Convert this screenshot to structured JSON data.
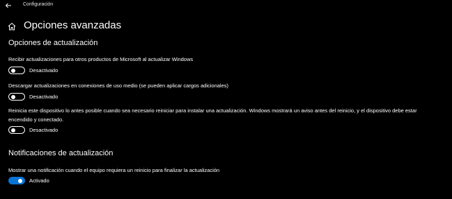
{
  "window": {
    "app_title": "Configuración",
    "back_icon": "back-arrow-icon"
  },
  "page": {
    "title": "Opciones avanzadas",
    "home_icon": "home-icon"
  },
  "update_options": {
    "heading": "Opciones de actualización",
    "items": [
      {
        "description": "Recibir actualizaciones para otros productos de Microsoft al actualizar Windows",
        "state_label": "Desactivado",
        "on": false
      },
      {
        "description": "Descargar actualizaciones en conexiones de uso medio (se pueden aplicar cargos adicionales)",
        "state_label": "Desactivado",
        "on": false
      },
      {
        "description_line1": "Reinicia este dispositivo lo antes posible cuando sea necesario reiniciar para instalar una actualización. Windows mostrará un aviso antes del reinicio, y el dispositivo debe estar",
        "description_line2": "encendido y conectado.",
        "state_label": "Desactivado",
        "on": false
      }
    ]
  },
  "notifications": {
    "heading": "Notificaciones de actualización",
    "items": [
      {
        "description": "Mostrar una notificación cuando el equipo requiera un reinicio para finalizar la actualización",
        "state_label": "Activado",
        "on": true
      }
    ]
  },
  "colors": {
    "background": "#000000",
    "accent": "#0a74d4",
    "text": "#ffffff"
  }
}
